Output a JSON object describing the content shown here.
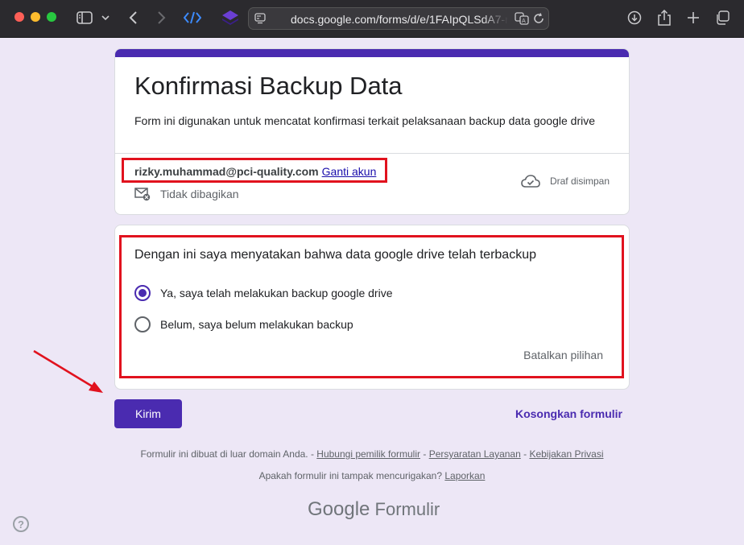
{
  "browser": {
    "url": "docs.google.com/forms/d/e/1FAIpQLSdA7-m"
  },
  "form": {
    "title": "Konfirmasi Backup Data",
    "description": "Form ini digunakan untuk mencatat konfirmasi terkait pelaksanaan backup data google drive",
    "account_email": "rizky.muhammad@pci-quality.com",
    "switch_account": "Ganti akun",
    "not_shared": "Tidak dibagikan",
    "draft_saved": "Draf disimpan",
    "accent_color": "#4a2bb0"
  },
  "question": {
    "title": "Dengan ini saya menyatakan bahwa data google drive telah terbackup",
    "options": [
      {
        "label": "Ya, saya telah melakukan backup google drive",
        "selected": true
      },
      {
        "label": "Belum, saya belum melakukan backup",
        "selected": false
      }
    ],
    "clear_selection": "Batalkan pilihan"
  },
  "actions": {
    "submit": "Kirim",
    "clear_form": "Kosongkan formulir"
  },
  "footer": {
    "line1_prefix": "Formulir ini dibuat di luar domain Anda. - ",
    "contact_owner": "Hubungi pemilik formulir",
    "sep": " - ",
    "terms": "Persyaratan Layanan",
    "privacy": "Kebijakan Privasi",
    "line2_prefix": "Apakah formulir ini tampak mencurigakan? ",
    "report": "Laporkan",
    "brand_google": "Google",
    "brand_forms": "Formulir"
  },
  "annotation_color": "#e1121e"
}
